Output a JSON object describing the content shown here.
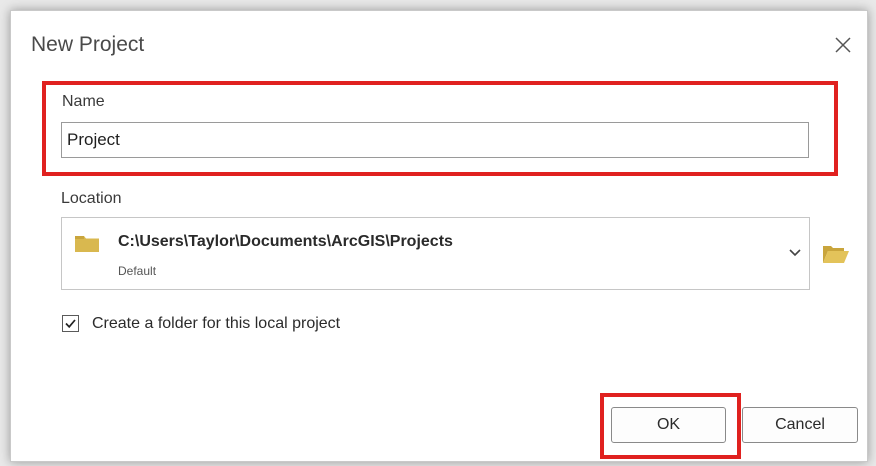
{
  "dialog": {
    "title": "New Project",
    "close_icon": "close-icon"
  },
  "name_section": {
    "label": "Name",
    "value": "Project"
  },
  "location_section": {
    "label": "Location",
    "path": "C:\\Users\\Taylor\\Documents\\ArcGIS\\Projects",
    "subtitle": "Default",
    "folder_icon": "folder-icon",
    "dropdown_icon": "chevron-down-icon",
    "browse_icon": "open-folder-icon"
  },
  "options": {
    "create_folder_label": "Create a folder for this local project",
    "create_folder_checked": true
  },
  "buttons": {
    "ok_label": "OK",
    "cancel_label": "Cancel"
  },
  "colors": {
    "highlight": "#e0211f",
    "folder": "#d9b84f"
  }
}
